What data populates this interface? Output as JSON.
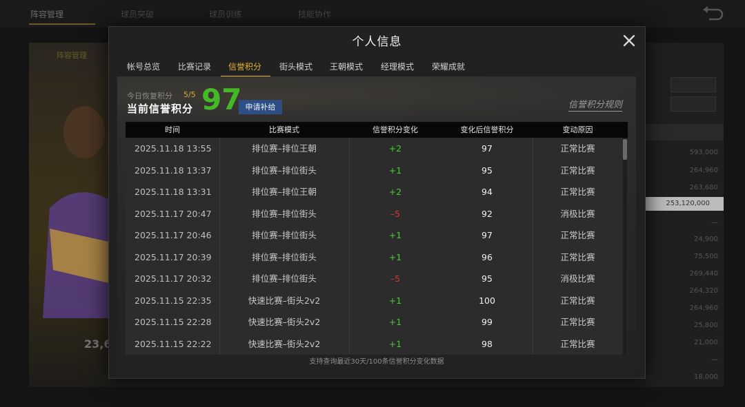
{
  "background": {
    "nav_tabs": [
      "阵容管理",
      "球员突破",
      "球员训练",
      "技能协作"
    ],
    "left_label": "阵容管理",
    "left_value": "23,6",
    "right_values": [
      "593,000",
      "264,960",
      "263,680",
      "253,120,000",
      "—",
      "24,900",
      "75,500",
      "269,440",
      "264,320",
      "264,960",
      "25,800",
      "21,000",
      "—",
      "18,000"
    ]
  },
  "modal": {
    "title": "个人信息",
    "tabs": [
      {
        "label": "帐号总览",
        "active": false
      },
      {
        "label": "比赛记录",
        "active": false
      },
      {
        "label": "信誉积分",
        "active": true
      },
      {
        "label": "街头模式",
        "active": false
      },
      {
        "label": "王朝模式",
        "active": false
      },
      {
        "label": "经理模式",
        "active": false
      },
      {
        "label": "荣耀成就",
        "active": false
      }
    ]
  },
  "credit": {
    "restore_label": "今日恢复积分",
    "restore_count": "5/5",
    "current_label": "当前信誉积分",
    "current_score": "97",
    "apply_button": "申请补给",
    "rules_link": "信誉积分规则",
    "score_color": "#45b82a"
  },
  "table": {
    "headers": {
      "time": "时间",
      "mode": "比赛模式",
      "change": "信誉积分变化",
      "after": "变化后信誉积分",
      "reason": "变动原因"
    },
    "rows": [
      {
        "time": "2025.11.18  13:55",
        "mode": "排位赛–排位王朝",
        "change": "+2",
        "after": "97",
        "reason": "正常比赛"
      },
      {
        "time": "2025.11.18  13:37",
        "mode": "排位赛–排位街头",
        "change": "+1",
        "after": "95",
        "reason": "正常比赛"
      },
      {
        "time": "2025.11.18  13:31",
        "mode": "排位赛–排位王朝",
        "change": "+2",
        "after": "94",
        "reason": "正常比赛"
      },
      {
        "time": "2025.11.17  20:47",
        "mode": "排位赛–排位街头",
        "change": "–5",
        "after": "92",
        "reason": "消极比赛"
      },
      {
        "time": "2025.11.17  20:46",
        "mode": "排位赛–排位街头",
        "change": "+1",
        "after": "97",
        "reason": "正常比赛"
      },
      {
        "time": "2025.11.17  20:39",
        "mode": "排位赛–排位街头",
        "change": "+1",
        "after": "96",
        "reason": "正常比赛"
      },
      {
        "time": "2025.11.17  20:32",
        "mode": "排位赛–排位街头",
        "change": "–5",
        "after": "95",
        "reason": "消极比赛"
      },
      {
        "time": "2025.11.15  22:35",
        "mode": "快速比赛–街头2v2",
        "change": "+1",
        "after": "100",
        "reason": "正常比赛"
      },
      {
        "time": "2025.11.15  22:28",
        "mode": "快速比赛–街头2v2",
        "change": "+1",
        "after": "99",
        "reason": "正常比赛"
      },
      {
        "time": "2025.11.15  22:22",
        "mode": "快速比赛–街头2v2",
        "change": "+1",
        "after": "98",
        "reason": "正常比赛"
      }
    ],
    "footnote": "支持查询最近30天/100条信誉积分变化数据"
  }
}
